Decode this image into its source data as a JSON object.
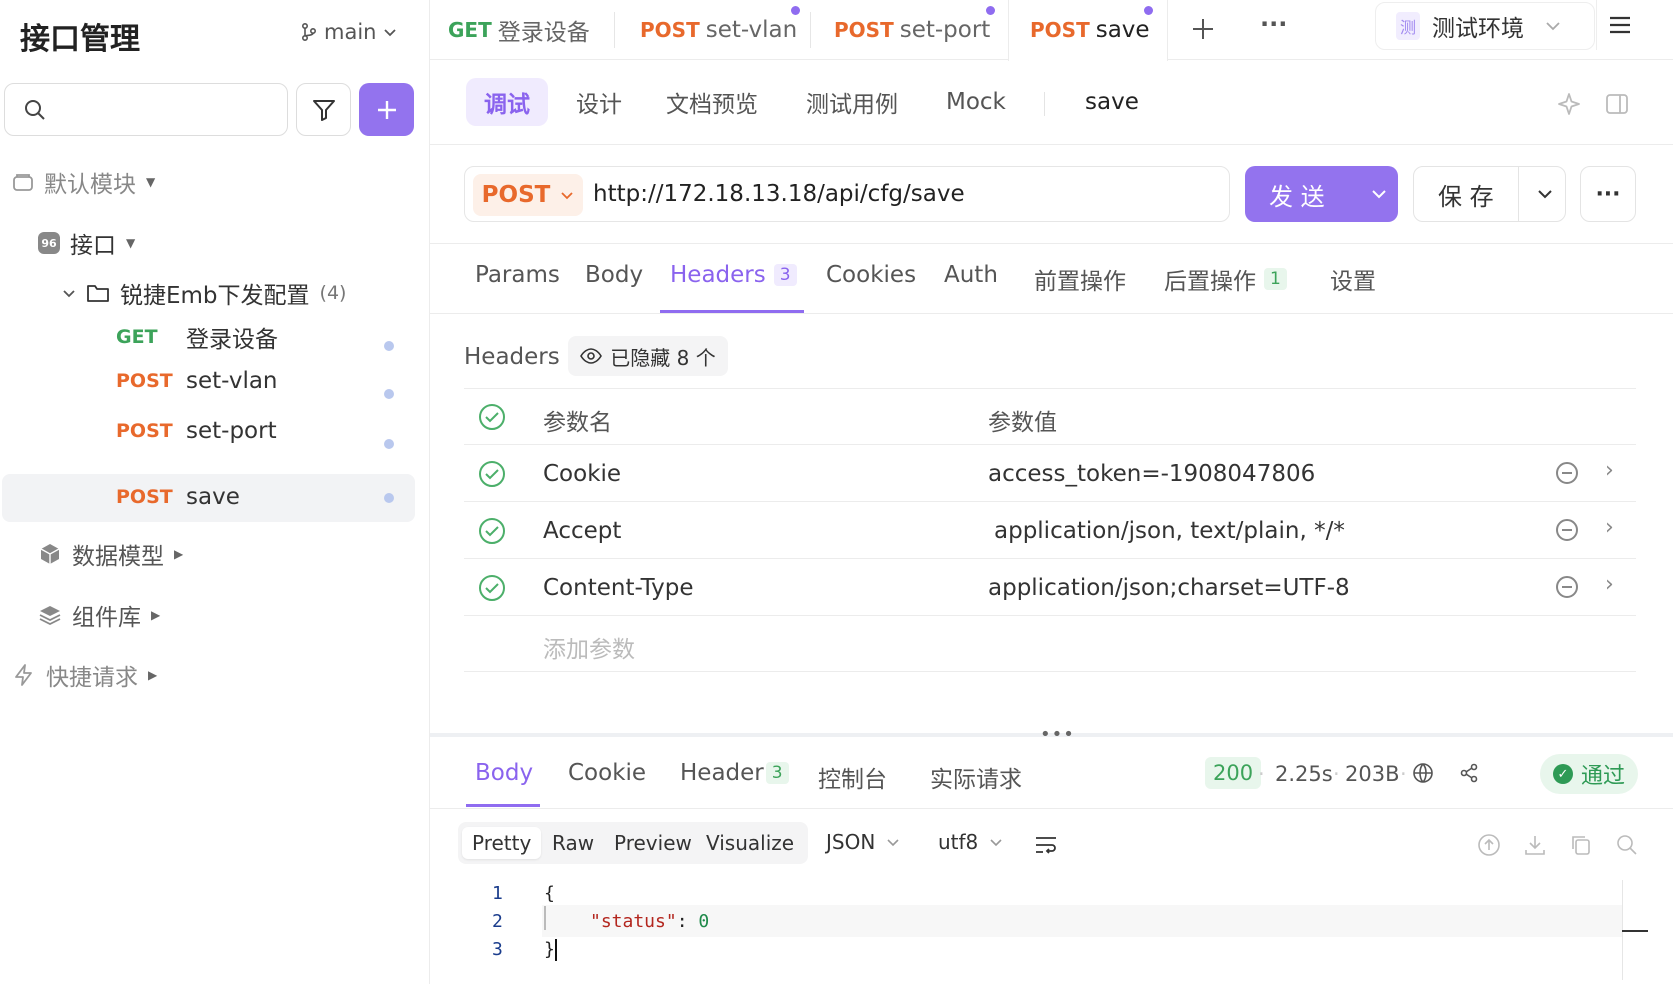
{
  "sidebar": {
    "title": "接口管理",
    "branch": "main",
    "search_placeholder": "",
    "tree": {
      "default_module": "默认模块",
      "api_group": "接口",
      "folder": {
        "name": "锐捷Emb下发配置",
        "count": "(4)"
      },
      "endpoints": [
        {
          "method": "GET",
          "name": "登录设备"
        },
        {
          "method": "POST",
          "name": "set-vlan"
        },
        {
          "method": "POST",
          "name": "set-port"
        },
        {
          "method": "POST",
          "name": "save"
        }
      ],
      "data_models": "数据模型",
      "components": "组件库",
      "quick_requests": "快捷请求"
    }
  },
  "tabs": [
    {
      "method": "GET",
      "name": "登录设备"
    },
    {
      "method": "POST",
      "name": "set-vlan"
    },
    {
      "method": "POST",
      "name": "set-port"
    },
    {
      "method": "POST",
      "name": "save"
    }
  ],
  "environment": {
    "badge": "测",
    "name": "测试环境"
  },
  "subnav": {
    "items": [
      "调试",
      "设计",
      "文档预览",
      "测试用例",
      "Mock"
    ],
    "active": "调试",
    "endpoint_name": "save"
  },
  "request": {
    "method": "POST",
    "url": "http://172.18.13.18/api/cfg/save",
    "send_label": "发 送",
    "save_label": "保 存"
  },
  "request_tabs": [
    {
      "label": "Params"
    },
    {
      "label": "Body"
    },
    {
      "label": "Headers",
      "badge": "3"
    },
    {
      "label": "Cookies"
    },
    {
      "label": "Auth"
    },
    {
      "label": "前置操作"
    },
    {
      "label": "后置操作",
      "badge": "1"
    },
    {
      "label": "设置"
    }
  ],
  "headers": {
    "section_label": "Headers",
    "hidden_label": "已隐藏 8 个",
    "col_name": "参数名",
    "col_value": "参数值",
    "rows": [
      {
        "name": "Cookie",
        "value": "access_token=-1908047806"
      },
      {
        "name": "Accept",
        "value": "application/json, text/plain, */*"
      },
      {
        "name": "Content-Type",
        "value": "application/json;charset=UTF-8"
      }
    ],
    "add_placeholder": "添加参数"
  },
  "response": {
    "tabs": [
      {
        "label": "Body"
      },
      {
        "label": "Cookie"
      },
      {
        "label": "Header",
        "badge": "3"
      },
      {
        "label": "控制台"
      },
      {
        "label": "实际请求"
      }
    ],
    "status_code": "200",
    "time": "2.25s",
    "size": "203B",
    "result": "通过",
    "view_modes": [
      "Pretty",
      "Raw",
      "Preview",
      "Visualize"
    ],
    "format": "JSON",
    "encoding": "utf8",
    "code_lines": [
      {
        "n": "1",
        "text": "{"
      },
      {
        "n": "2",
        "key": "\"status\"",
        "value": "0"
      },
      {
        "n": "3",
        "text": "}"
      }
    ]
  },
  "colors": {
    "accent": "#9373ee",
    "get": "#3ca35a",
    "post": "#e8692c",
    "pass": "#2e9a55"
  }
}
